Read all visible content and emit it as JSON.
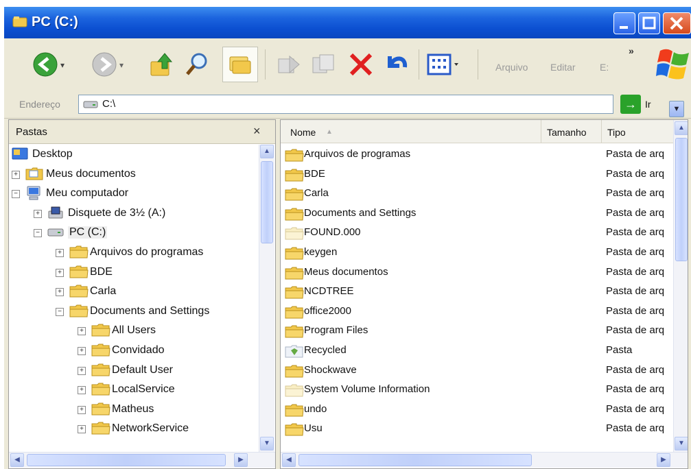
{
  "window": {
    "title": "PC (C:)",
    "title_icon": "drive-folder-icon",
    "buttons": {
      "minimize": "minimize-icon",
      "maximize": "maximize-icon",
      "close": "close-icon"
    }
  },
  "toolbar": {
    "tools": [
      "back-icon",
      "forward-icon",
      "up-folder-icon",
      "search-icon",
      "folders-icon",
      "move-to-icon",
      "copy-to-icon",
      "delete-icon",
      "undo-icon",
      "views-icon"
    ],
    "menus": [
      "Arquivo",
      "Editar",
      "E:"
    ],
    "overflow": "»"
  },
  "address": {
    "label": "Endereço",
    "value": "C:\\",
    "go_label": "Ir"
  },
  "folders_pane": {
    "title": "Pastas",
    "close": "×",
    "tree": [
      {
        "label": "Desktop",
        "icon": "desktop-icon",
        "expander": ""
      },
      {
        "label": "Meus documentos",
        "icon": "my-documents-icon",
        "expander": "+"
      },
      {
        "label": "Meu computador",
        "icon": "my-computer-icon",
        "expander": "−"
      },
      {
        "label": "Disquete de 3½ (A:)",
        "icon": "floppy-drive-icon",
        "expander": "+"
      },
      {
        "label": "PC (C:)",
        "icon": "hard-drive-icon",
        "expander": "−"
      },
      {
        "label": "Arquivos do programas",
        "icon": "folder-icon",
        "expander": "+"
      },
      {
        "label": "BDE",
        "icon": "folder-icon",
        "expander": "+"
      },
      {
        "label": "Carla",
        "icon": "folder-icon",
        "expander": "+"
      },
      {
        "label": "Documents and Settings",
        "icon": "folder-icon",
        "expander": "−"
      },
      {
        "label": "All Users",
        "icon": "folder-icon",
        "expander": "+"
      },
      {
        "label": "Convidado",
        "icon": "folder-icon",
        "expander": "+"
      },
      {
        "label": "Default User",
        "icon": "folder-icon",
        "expander": "+"
      },
      {
        "label": "LocalService",
        "icon": "folder-icon",
        "expander": "+"
      },
      {
        "label": "Matheus",
        "icon": "folder-icon",
        "expander": "+"
      },
      {
        "label": "NetworkService",
        "icon": "folder-icon",
        "expander": "+"
      }
    ]
  },
  "files_pane": {
    "columns": [
      "Nome",
      "Tamanho",
      "Tipo"
    ],
    "sort_indicator": "▲",
    "rows": [
      {
        "name": "Arquivos de programas",
        "type": "Pasta de arq",
        "icon": "folder-icon"
      },
      {
        "name": "BDE",
        "type": "Pasta de arq",
        "icon": "folder-icon"
      },
      {
        "name": "Carla",
        "type": "Pasta de arq",
        "icon": "folder-icon"
      },
      {
        "name": "Documents and Settings",
        "type": "Pasta de arq",
        "icon": "folder-icon"
      },
      {
        "name": "FOUND.000",
        "type": "Pasta de arq",
        "icon": "hidden-folder-icon"
      },
      {
        "name": "keygen",
        "type": "Pasta de arq",
        "icon": "folder-icon"
      },
      {
        "name": "Meus documentos",
        "type": "Pasta de arq",
        "icon": "folder-icon"
      },
      {
        "name": "NCDTREE",
        "type": "Pasta de arq",
        "icon": "folder-icon"
      },
      {
        "name": "office2000",
        "type": "Pasta de arq",
        "icon": "folder-icon"
      },
      {
        "name": "Program Files",
        "type": "Pasta de arq",
        "icon": "folder-icon"
      },
      {
        "name": "Recycled",
        "type": "Pasta",
        "icon": "recycle-folder-icon"
      },
      {
        "name": "Shockwave",
        "type": "Pasta de arq",
        "icon": "folder-icon"
      },
      {
        "name": "System Volume Information",
        "type": "Pasta de arq",
        "icon": "hidden-folder-icon"
      },
      {
        "name": "undo",
        "type": "Pasta de arq",
        "icon": "folder-icon"
      },
      {
        "name": "Usu",
        "type": "Pasta de arq",
        "icon": "folder-icon"
      }
    ]
  },
  "colors": {
    "titlebar": "#0b4fd1",
    "chrome": "#ece9d8",
    "folder": "#f2c84b",
    "delete": "#e02020",
    "go": "#2aa22a"
  }
}
